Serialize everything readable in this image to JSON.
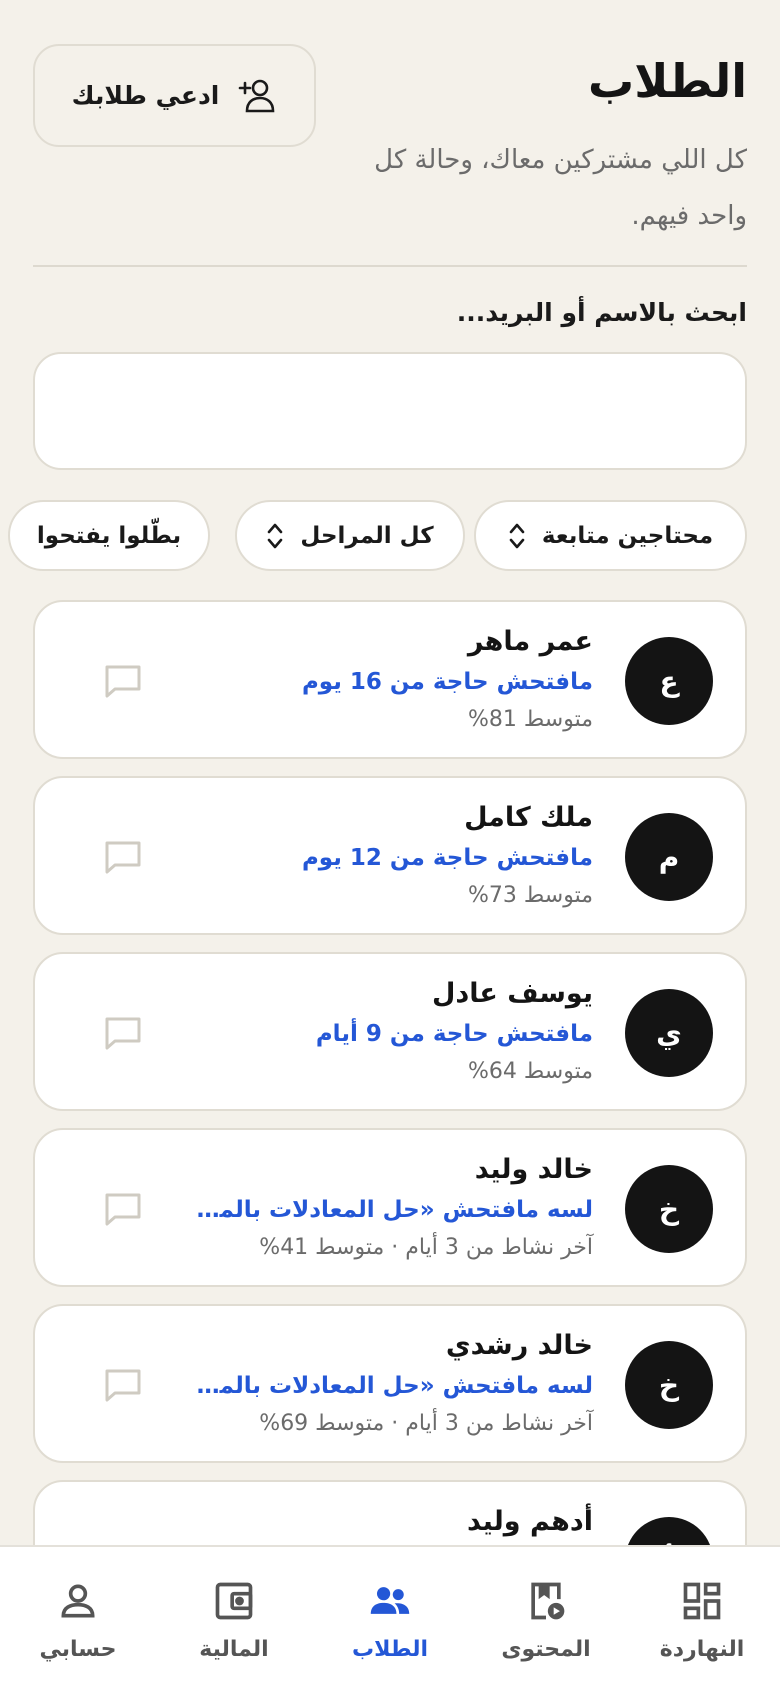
{
  "header": {
    "title": "الطلاب",
    "subtitle": "كل اللي مشتركين معاك، وحالة كل واحد فيهم.",
    "invite_label": "ادعي طلابك"
  },
  "search": {
    "label": "ابحث بالاسم أو البريد...",
    "value": "",
    "placeholder": ""
  },
  "filters": [
    {
      "label": "محتاجين متابعة",
      "icon": "sort-arrows-icon"
    },
    {
      "label": "كل المراحل",
      "icon": "sort-arrows-icon"
    },
    {
      "label": "بطّلوا يفتحوا"
    }
  ],
  "students": [
    {
      "initial": "ع",
      "name": "عمر ماهر",
      "status": "مافتحش حاجة من 16 يوم",
      "meta": "متوسط 81%"
    },
    {
      "initial": "م",
      "name": "ملك كامل",
      "status": "مافتحش حاجة من 12 يوم",
      "meta": "متوسط 73%"
    },
    {
      "initial": "ي",
      "name": "يوسف عادل",
      "status": "مافتحش حاجة من 9 أيام",
      "meta": "متوسط 64%"
    },
    {
      "initial": "خ",
      "name": "خالد وليد",
      "status": "لسه مافتحش «حل المعادلات بالمص...",
      "meta": "آخر نشاط من 3 أيام · متوسط 41%"
    },
    {
      "initial": "خ",
      "name": "خالد رشدي",
      "status": "لسه مافتحش «حل المعادلات بالمص...",
      "meta": "آخر نشاط من 3 أيام · متوسط 69%"
    },
    {
      "initial": "أ",
      "name": "أدهم وليد",
      "status": "",
      "meta": ""
    }
  ],
  "nav": [
    {
      "label": "النهاردة",
      "icon": "dashboard-icon",
      "active": false
    },
    {
      "label": "المحتوى",
      "icon": "content-icon",
      "active": false
    },
    {
      "label": "الطلاب",
      "icon": "students-icon",
      "active": true
    },
    {
      "label": "المالية",
      "icon": "wallet-icon",
      "active": false
    },
    {
      "label": "حسابي",
      "icon": "person-icon",
      "active": false
    }
  ],
  "colors": {
    "background": "#F4F1EA",
    "accent": "#2457D6",
    "avatar": "#141414",
    "card": "#FFFFFF"
  }
}
